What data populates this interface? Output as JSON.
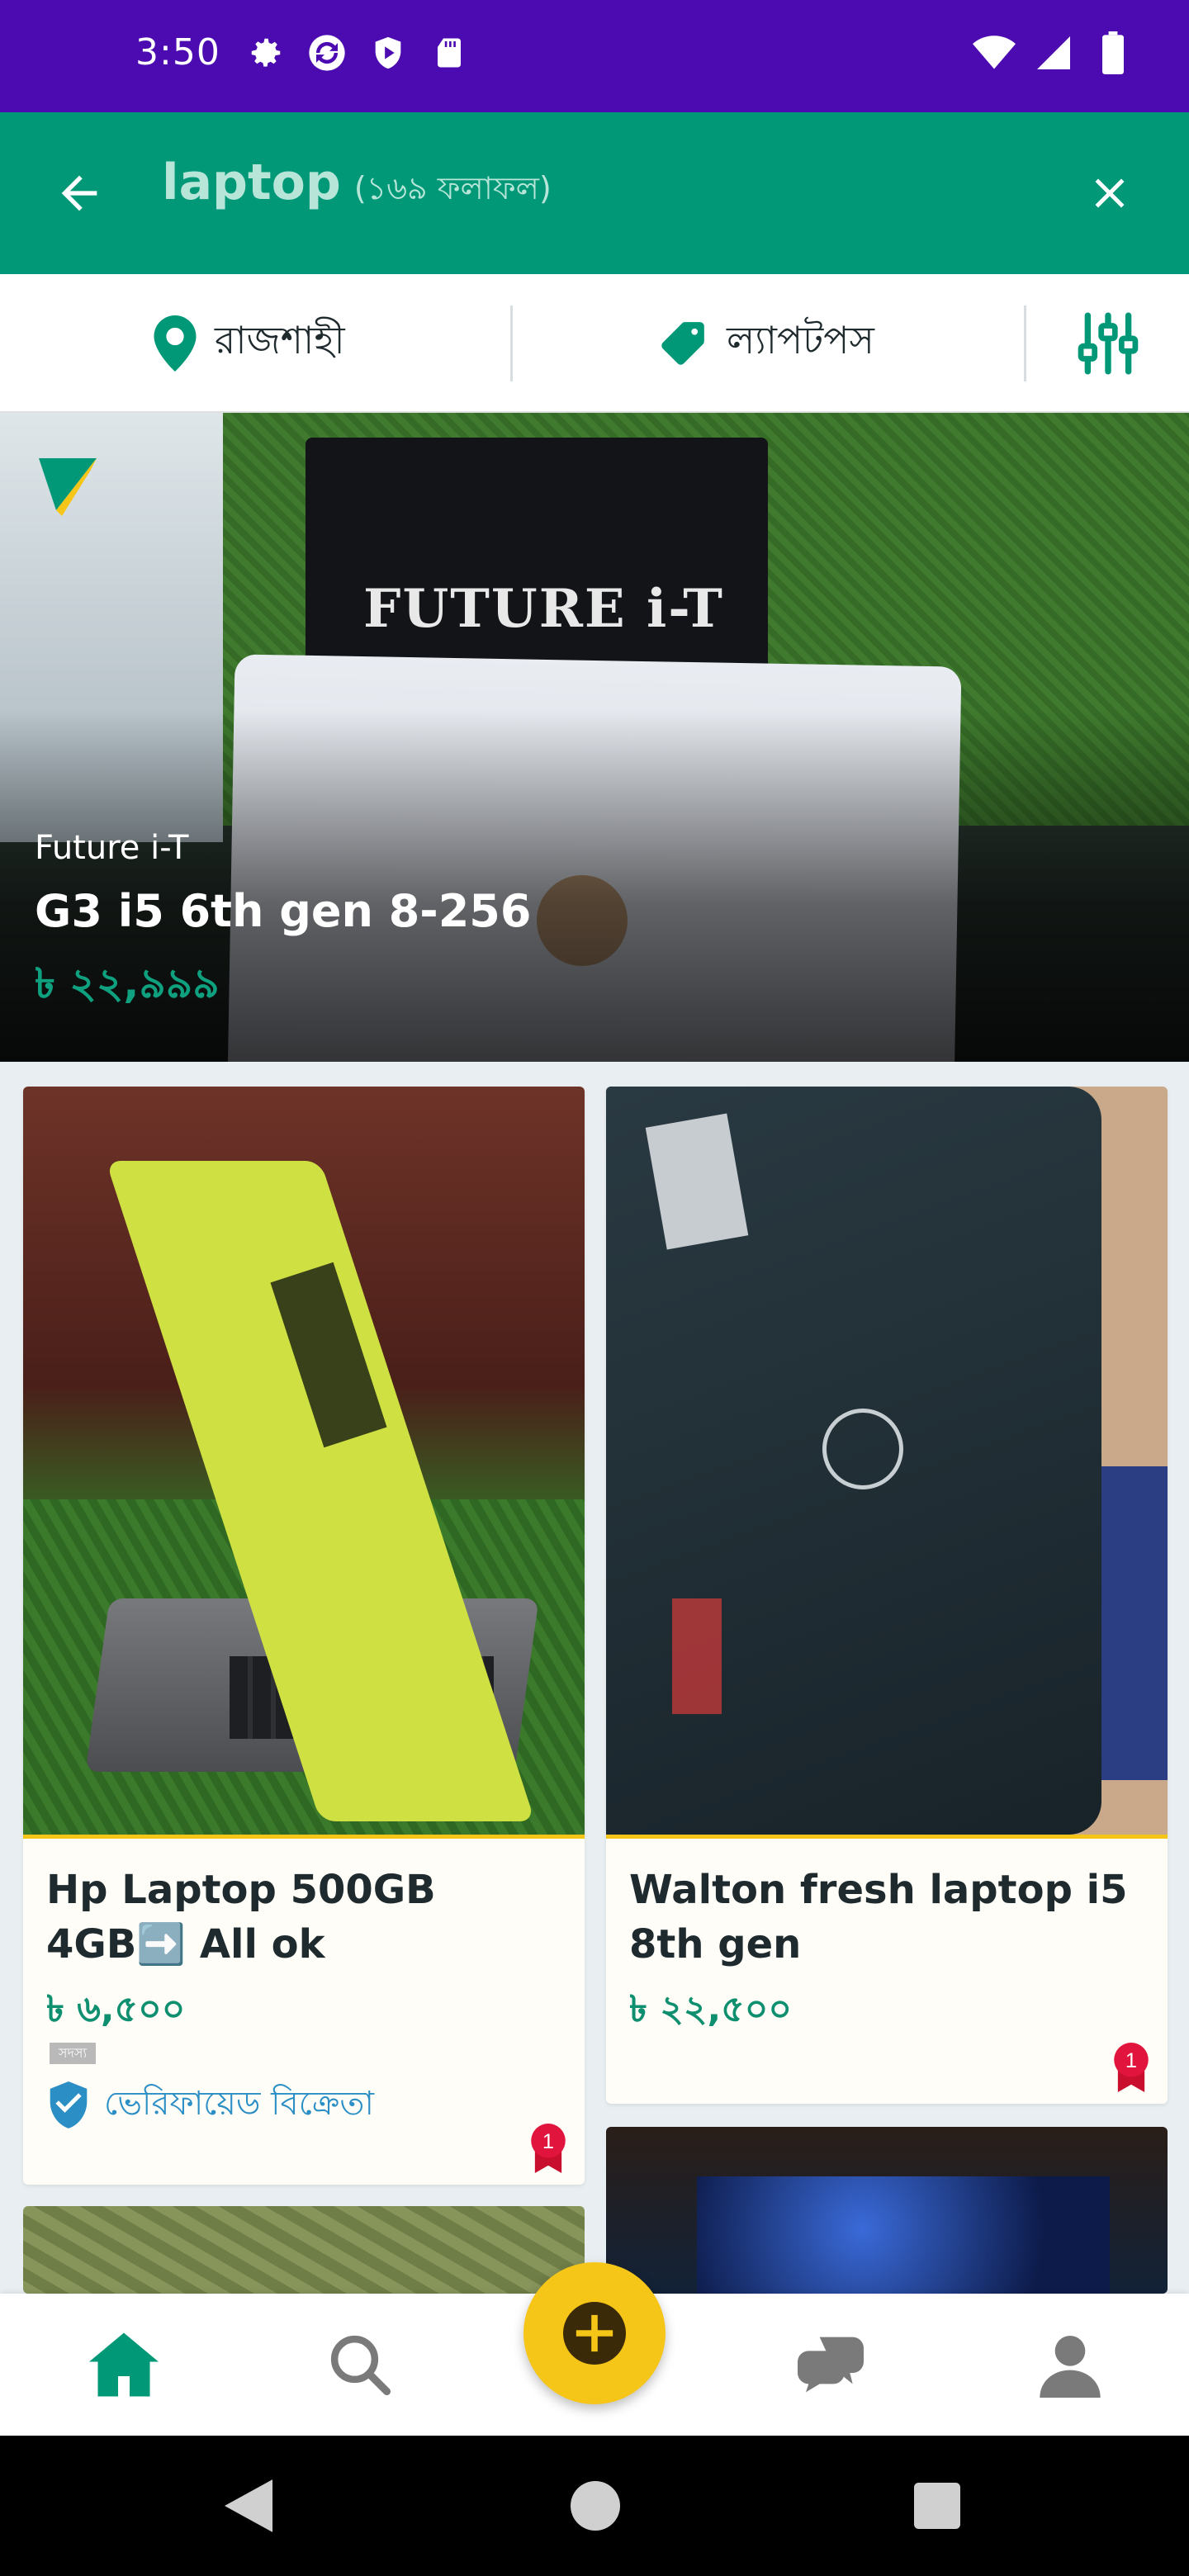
{
  "status_bar": {
    "time": "3:50",
    "left_icons": [
      "settings-icon",
      "sync-icon",
      "shield-icon",
      "sd-card-icon"
    ],
    "right_icons": [
      "wifi-icon",
      "signal-icon",
      "battery-icon"
    ],
    "background": "#4b0bb1"
  },
  "app_bar": {
    "query": "laptop",
    "result_count": "(১৬৯ ফলাফল)",
    "background": "#009877"
  },
  "filters": {
    "location": "রাজশাহী",
    "category": "ল্যাপটপস"
  },
  "featured": {
    "seller": "Future i-T",
    "title": "G3 i5 6th gen 8-256",
    "price": "৳ ২২,৯৯৯",
    "sign_text": "FUTURE i-T"
  },
  "listings": [
    {
      "title": "Hp Laptop 500GB 4GB➡️ All ok",
      "price": "৳ ৬,৫০০",
      "member_tag": "সদস্য",
      "verified_label": "ভেরিফায়েড বিক্রেতা",
      "rank": "1"
    },
    {
      "title": "Walton fresh laptop i5 8th gen",
      "price": "৳ ২২,৫০০",
      "rank": "1"
    }
  ],
  "bottom_nav": {
    "items": [
      "home-icon",
      "search-icon",
      "post-ad-icon",
      "chat-icon",
      "account-icon"
    ],
    "active": "home-icon"
  },
  "colors": {
    "accent": "#009877",
    "price": "#0e8f6f",
    "fab": "#f5c518",
    "verified": "#2b8fc6"
  }
}
